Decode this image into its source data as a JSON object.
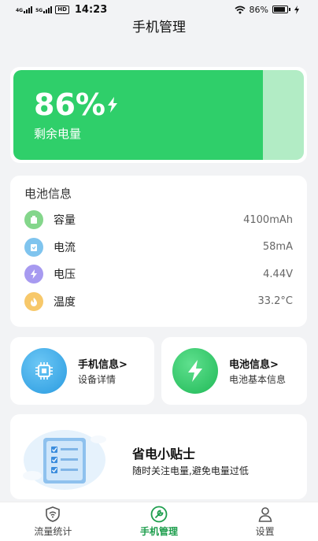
{
  "status_bar": {
    "net1": "4G",
    "net2": "5G",
    "badge": "HD",
    "time": "14:23",
    "battery": "86%",
    "wifi_icon": "wifi-icon",
    "charge_icon": "charging-bolt-icon"
  },
  "header": {
    "title": "手机管理"
  },
  "battery": {
    "percent": "86%",
    "level": 0.86,
    "label": "剩余电量",
    "colors": {
      "fill": "#2fcf6a",
      "track": "#b2ecc5"
    }
  },
  "battery_info": {
    "title": "电池信息",
    "rows": [
      {
        "icon": "capacity-icon",
        "label": "容量",
        "value": "4100mAh",
        "color": "#84d68b"
      },
      {
        "icon": "current-icon",
        "label": "电流",
        "value": "58mA",
        "color": "#7fc4ee"
      },
      {
        "icon": "voltage-icon",
        "label": "电压",
        "value": "4.44V",
        "color": "#a79af0"
      },
      {
        "icon": "temperature-icon",
        "label": "温度",
        "value": "33.2°C",
        "color": "#f7c86a"
      }
    ]
  },
  "shortcuts": {
    "phone": {
      "title": "手机信息>",
      "sub": "设备详情",
      "icon": "chip-icon",
      "color": "#3aa8e8"
    },
    "battery": {
      "title": "电池信息>",
      "sub": "电池基本信息",
      "icon": "bolt-icon",
      "color": "#2fcf6a"
    }
  },
  "tips": {
    "title": "省电小贴士",
    "sub": "随时关注电量,避免电量过低",
    "icon": "checklist-illustration-icon"
  },
  "tab_bar": {
    "tabs": [
      {
        "label": "流量统计",
        "icon": "wifi-shield-icon",
        "active": false
      },
      {
        "label": "手机管理",
        "icon": "wrench-icon",
        "active": true
      },
      {
        "label": "设置",
        "icon": "person-icon",
        "active": false
      }
    ],
    "active_color": "#1e9e4d"
  }
}
